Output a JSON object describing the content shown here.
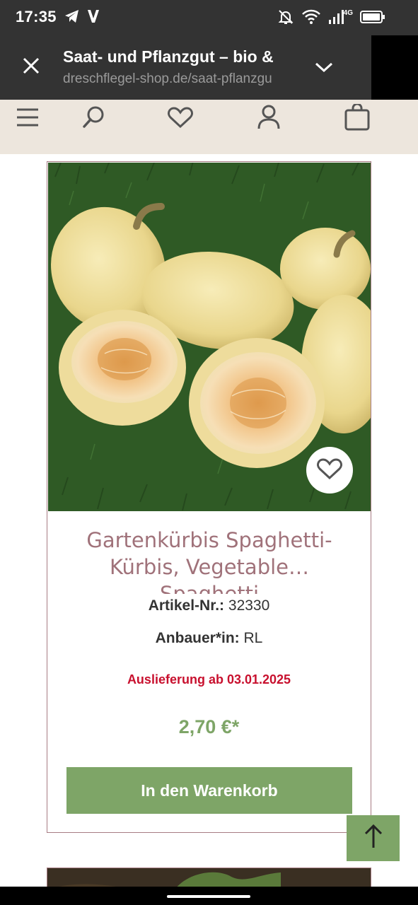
{
  "status_bar": {
    "time": "17:35",
    "network": "4G",
    "icons": [
      "telegram-icon",
      "v-app-icon",
      "bell-muted-icon",
      "wifi-icon",
      "signal-icon",
      "battery-icon"
    ]
  },
  "browser": {
    "title": "Saat- und Pflanzgut – bio &",
    "url": "dreschflegel-shop.de/saat-pflanzgu",
    "icons": [
      "close-icon",
      "chevron-down-icon",
      "more-vert-icon"
    ]
  },
  "site_header": {
    "icons": [
      "menu-icon",
      "search-icon",
      "heart-icon",
      "user-icon",
      "cart-icon"
    ]
  },
  "product": {
    "title": "Gartenkürbis Spaghetti-Kürbis, Vegetable… Spaghetti",
    "article_label": "Artikel-Nr.:",
    "article_number": "32330",
    "grower_label": "Anbauer*in:",
    "grower": "RL",
    "delivery": "Auslieferung ab 03.01.2025",
    "price": "2,70 €*",
    "cart_button": "In den Warenkorb"
  },
  "colors": {
    "status_bar": "#333333",
    "header_bg": "#ede6dd",
    "accent_green": "#7ea567",
    "title_rose": "#a0727a",
    "delivery_red": "#c8102e",
    "card_border": "#a77c83"
  }
}
